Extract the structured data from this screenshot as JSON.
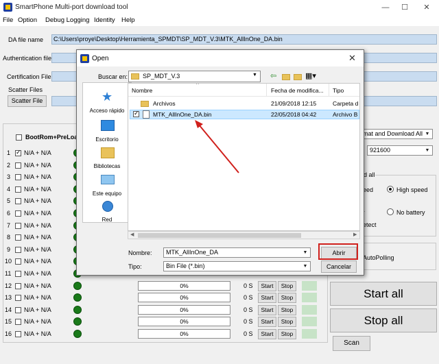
{
  "window": {
    "title": "SmartPhone Multi-port download tool"
  },
  "menu": [
    "File",
    "Option",
    "Debug Logging",
    "Identity",
    "Help"
  ],
  "main": {
    "da_label": "DA file name",
    "da_value": "C:\\Users\\proye\\Desktop\\Herramienta_SPMDT\\SP_MDT_V.3\\MTK_AllInOne_DA.bin",
    "auth_label": "Authentication file",
    "cert_label": "Certification File",
    "scatter_group": "Scatter Files",
    "scatter_button": "Scatter File",
    "bootrom_label": "BootRom+PreLoad",
    "ports": [
      {
        "num": "1",
        "label": "N/A + N/A",
        "checked": true
      },
      {
        "num": "2",
        "label": "N/A + N/A",
        "checked": false
      },
      {
        "num": "3",
        "label": "N/A + N/A",
        "checked": false
      },
      {
        "num": "4",
        "label": "N/A + N/A",
        "checked": false
      },
      {
        "num": "5",
        "label": "N/A + N/A",
        "checked": false
      },
      {
        "num": "6",
        "label": "N/A + N/A",
        "checked": false
      },
      {
        "num": "7",
        "label": "N/A + N/A",
        "checked": false
      },
      {
        "num": "8",
        "label": "N/A + N/A",
        "checked": false
      },
      {
        "num": "9",
        "label": "N/A + N/A",
        "checked": false
      },
      {
        "num": "10",
        "label": "N/A + N/A",
        "checked": false
      },
      {
        "num": "11",
        "label": "N/A + N/A",
        "checked": false
      },
      {
        "num": "12",
        "label": "N/A + N/A",
        "checked": false
      },
      {
        "num": "13",
        "label": "N/A + N/A",
        "checked": false
      },
      {
        "num": "14",
        "label": "N/A + N/A",
        "checked": false
      },
      {
        "num": "15",
        "label": "N/A + N/A",
        "checked": false
      },
      {
        "num": "16",
        "label": "N/A + N/A",
        "checked": false
      }
    ],
    "progress_text": "0%",
    "time_text": "0 S",
    "start_label": "Start",
    "stop_label": "Stop"
  },
  "right": {
    "mode_value": "ormat and Download All",
    "baud_value": "921600",
    "group_label": "oad all",
    "speed_low": "peed",
    "speed_high": "High speed",
    "battery_partial": "ry",
    "no_battery": "No battery",
    "detect_partial": "detect",
    "autopolling": "eAutoPolling",
    "start_all": "Start all",
    "stop_all": "Stop all",
    "scan": "Scan"
  },
  "dialog": {
    "title": "Open",
    "lookin_label": "Buscar en:",
    "lookin_value": "SP_MDT_V.3",
    "places": [
      "Acceso rápido",
      "Escritorio",
      "Bibliotecas",
      "Este equipo",
      "Red"
    ],
    "columns": {
      "name": "Nombre",
      "date": "Fecha de modifica...",
      "type": "Tipo"
    },
    "files": [
      {
        "name": "Archivos",
        "date": "21/09/2018 12:15",
        "type": "Carpeta d"
      },
      {
        "name": "MTK_AllInOne_DA.bin",
        "date": "22/05/2018 04:42",
        "type": "Archivo B"
      }
    ],
    "filename_label": "Nombre:",
    "filename_value": "MTK_AllInOne_DA",
    "filetype_label": "Tipo:",
    "filetype_value": "Bin File (*.bin)",
    "open_button": "Abrir",
    "cancel_button": "Cancelar"
  },
  "colors": {
    "accent_field": "#c9dcf0",
    "status_green": "#1a7a1a",
    "annotation_red": "#d0201c"
  }
}
